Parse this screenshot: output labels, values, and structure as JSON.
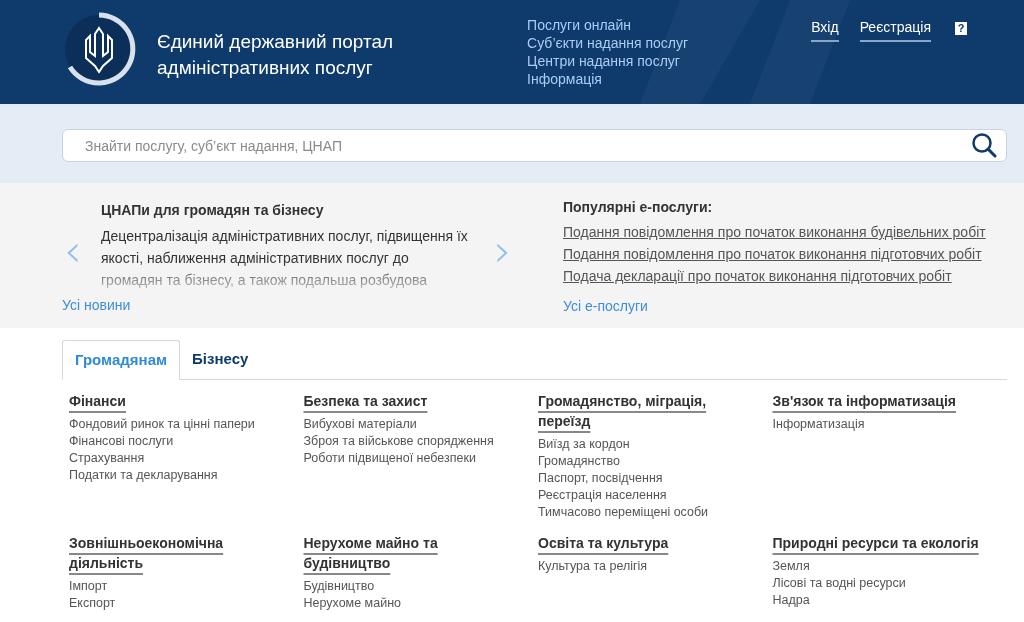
{
  "header": {
    "title_lines": [
      "Єдиний державний портал",
      "адміністративних послуг"
    ],
    "nav": [
      "Послуги онлайн",
      "Суб’єкти надання послуг",
      "Центри надання послуг",
      "Інформація"
    ],
    "auth": [
      "Вхід",
      "Реєстрація"
    ],
    "help": "?"
  },
  "search": {
    "placeholder": "Знайти послугу, суб’єкт надання, ЦНАП"
  },
  "news": {
    "title": "ЦНАПи для громадян та бізнесу",
    "text": "Децентралізація адміністративних послуг, підвищення їх якості, наближення адміністративних послуг до громадян та бізнесу, а також подальша розбудова",
    "all_link": "Усі новини",
    "prev": "‹",
    "next": "›"
  },
  "popular": {
    "title": "Популярні е-послуги:",
    "links": [
      "Подання повідомлення про початок виконання будівельних робіт",
      "Подання повідомлення про початок виконання підготовчих робіт",
      "Подача декларації про початок виконання підготовчих робіт"
    ],
    "all_link": "Усі е-послуги"
  },
  "tabs": [
    {
      "label": "Громадянам",
      "selected": true
    },
    {
      "label": "Бізнесу",
      "selected": false
    }
  ],
  "categories": [
    {
      "title_lines": [
        "Фінанси"
      ],
      "items": [
        "Фондовий ринок та цінні папери",
        "Фінансові послуги",
        "Страхування",
        "Податки та декларування"
      ]
    },
    {
      "title_lines": [
        "Безпека та захист"
      ],
      "items": [
        "Вибухові матеріали",
        "Зброя та військове спорядження",
        "Роботи підвищеної небезпеки"
      ]
    },
    {
      "title_lines": [
        "Громадянство, міграція,",
        "переїзд"
      ],
      "items": [
        "Виїзд за кордон",
        "Громадянство",
        "Паспорт, посвідчення",
        "Реєстрація населення",
        "Тимчасово переміщені особи"
      ]
    },
    {
      "title_lines": [
        "Зв'язок та інформатизація"
      ],
      "items": [
        "Інформатизація"
      ]
    },
    {
      "title_lines": [
        "Зовнішньоекономічна",
        "діяльність"
      ],
      "items": [
        "Імпорт",
        "Експорт"
      ]
    },
    {
      "title_lines": [
        "Нерухоме майно та",
        "будівництво"
      ],
      "items": [
        "Будівництво",
        "Нерухоме майно"
      ]
    },
    {
      "title_lines": [
        "Освіта та культура"
      ],
      "items": [
        "Культура та релігія"
      ]
    },
    {
      "title_lines": [
        "Природні ресурси та екологія"
      ],
      "items": [
        "Земля",
        "Лісові та водні ресурси",
        "Надра"
      ]
    }
  ]
}
